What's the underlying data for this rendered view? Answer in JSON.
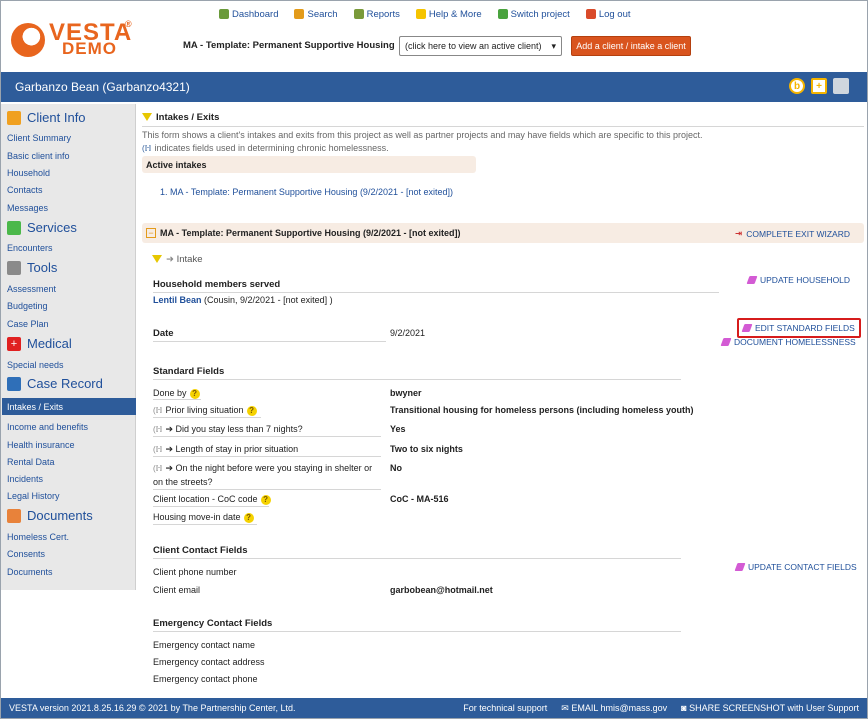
{
  "logo": {
    "brand": "VESTA",
    "reg": "®",
    "sub": "DEMO"
  },
  "topnav": [
    {
      "label": "Dashboard",
      "icon": "dashboard-icon",
      "color": "#6a9a3a"
    },
    {
      "label": "Search",
      "icon": "search-icon",
      "color": "#e39b1a"
    },
    {
      "label": "Reports",
      "icon": "reports-icon",
      "color": "#7a9a3a"
    },
    {
      "label": "Help & More",
      "icon": "help-icon",
      "color": "#f5c400"
    },
    {
      "label": "Switch project",
      "icon": "switch-project-icon",
      "color": "#4aa33e"
    },
    {
      "label": "Log out",
      "icon": "logout-icon",
      "color": "#d94a2a"
    }
  ],
  "header": {
    "project": "MA - Template: Permanent Supportive Housing",
    "client_select": "(click here to view an active client)",
    "add_client": "Add a client / intake a client"
  },
  "titlebar": {
    "client_name": "Garbanzo Bean (Garbanzo4321)"
  },
  "sidebar": {
    "client_info": "Client Info",
    "client_info_items": [
      "Client Summary",
      "Basic client info",
      "Household",
      "Contacts",
      "Messages"
    ],
    "services": "Services",
    "services_items": [
      "Encounters"
    ],
    "tools": "Tools",
    "tools_items": [
      "Assessment",
      "Budgeting",
      "Case Plan"
    ],
    "medical": "Medical",
    "medical_items": [
      "Special needs"
    ],
    "case_record": "Case Record",
    "case_record_items": [
      "Intakes / Exits",
      "Income and benefits",
      "Health insurance",
      "Rental Data",
      "Incidents",
      "Legal History"
    ],
    "documents": "Documents",
    "documents_items": [
      "Homeless Cert.",
      "Consents",
      "Documents"
    ]
  },
  "main": {
    "section_title": "Intakes / Exits",
    "note1": "This form shows a client's intakes and exits from this project as well as partner projects and may have fields which are specific to this project.",
    "note2": "indicates fields used in determining chronic homelessness.",
    "active_intakes_label": "Active intakes",
    "active_intake_item": "1. MA - Template: Permanent Supportive Housing (9/2/2021 - [not exited])",
    "episode_title": "MA - Template: Permanent Supportive Housing (9/2/2021 - [not exited])",
    "complete_exit": "COMPLETE EXIT WIZARD",
    "intake_label": "Intake",
    "household_label": "Household members served",
    "update_household": "UPDATE HOUSEHOLD",
    "household_member": "Lentil Bean",
    "household_member_detail": "(Cousin, 9/2/2021 - [not exited] )",
    "date_label": "Date",
    "date_value": "9/2/2021",
    "edit_standard": "EDIT STANDARD FIELDS",
    "document_homelessness": "DOCUMENT HOMELESSNESS",
    "standard_fields_label": "Standard Fields",
    "fields": [
      {
        "label": "Done by",
        "value": "bwyner"
      },
      {
        "label": "Prior living situation",
        "value": "Transitional housing for homeless persons (including homeless youth)"
      },
      {
        "label": "Did you stay less than 7 nights?",
        "value": "Yes"
      },
      {
        "label": "Length of stay in prior situation",
        "value": "Two to six nights"
      },
      {
        "label": "On the night before were you staying in shelter or",
        "label2": "on the streets?",
        "value": "No"
      },
      {
        "label": "Client location - CoC code",
        "value": "CoC - MA-516"
      },
      {
        "label": "Housing move-in date",
        "value": ""
      }
    ],
    "contact_fields_label": "Client Contact Fields",
    "update_contact": "UPDATE CONTACT FIELDS",
    "phone_label": "Client phone number",
    "email_label": "Client email",
    "email_value": "garbobean@hotmail.net",
    "emergency_label": "Emergency Contact Fields",
    "emergency_name": "Emergency contact name",
    "emergency_address": "Emergency contact address",
    "emergency_phone": "Emergency contact phone"
  },
  "footer": {
    "version": "VESTA version 2021.8.25.16.29 © 2021 by",
    "company": "The Partnership Center, Ltd.",
    "support": "For technical support",
    "email": "EMAIL hmis@mass.gov",
    "share": "SHARE SCREENSHOT with User Support"
  }
}
